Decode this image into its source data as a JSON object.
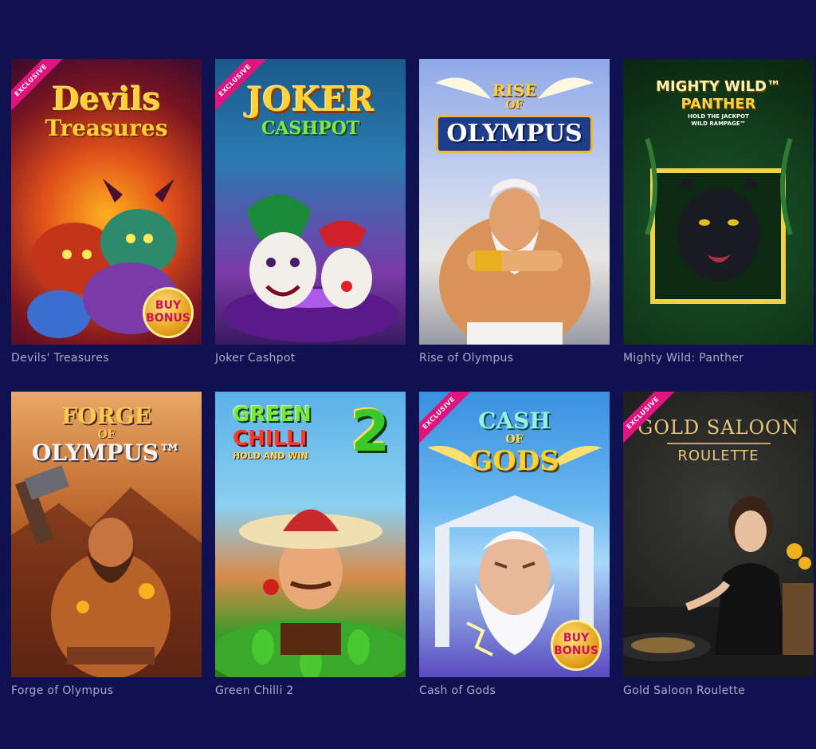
{
  "games": [
    {
      "title": "Devils' Treasures",
      "logo_line1": "Devils",
      "logo_line2": "Treasures",
      "ribbon": "EXCLUSIVE",
      "badge_line1": "BUY",
      "badge_line2": "BONUS"
    },
    {
      "title": "Joker Cashpot",
      "logo_line1": "JOKER",
      "logo_line2": "CASHPOT",
      "ribbon": "EXCLUSIVE"
    },
    {
      "title": "Rise of Olympus",
      "logo_line1": "RISE",
      "logo_line2": "OF",
      "logo_line3": "OLYMPUS"
    },
    {
      "title": "Mighty Wild: Panther",
      "logo_line1": "MIGHTY WILD™",
      "logo_line2": "PANTHER",
      "logo_line3": "HOLD THE JACKPOT",
      "logo_line4": "WILD RAMPAGE™"
    },
    {
      "title": "Forge of Olympus",
      "logo_line1": "FORGE",
      "logo_line2": "OF",
      "logo_line3": "OLYMPUS™"
    },
    {
      "title": "Green Chilli 2",
      "logo_line1": "GREEN",
      "logo_line2": "CHILLI",
      "logo_line3": "HOLD AND WIN",
      "logo_num": "2"
    },
    {
      "title": "Cash of Gods",
      "logo_line1": "CASH",
      "logo_line2": "OF",
      "logo_line3": "GODS",
      "ribbon": "EXCLUSIVE",
      "badge_line1": "BUY",
      "badge_line2": "BONUS"
    },
    {
      "title": "Gold Saloon Roulette",
      "logo_line1": "GOLD SALOON",
      "logo_line2": "ROULETTE",
      "ribbon": "EXCLUSIVE"
    }
  ],
  "colors": {
    "background": "#0f1150",
    "caption": "#a9abc6",
    "ribbon": "#e0147f"
  }
}
